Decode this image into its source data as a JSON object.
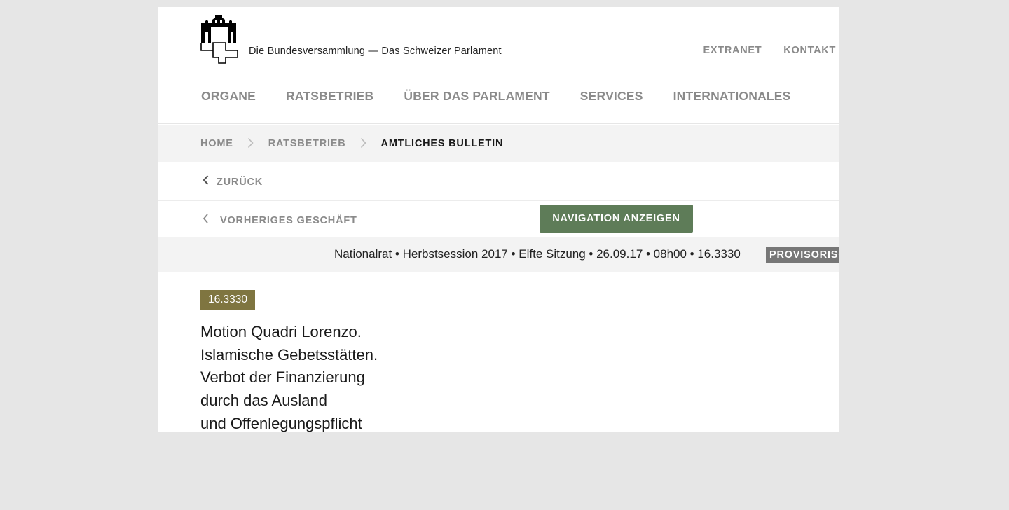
{
  "header": {
    "site_title": "Die Bundesversammlung — Das Schweizer Parlament",
    "meta_links": [
      "EXTRANET",
      "KONTAKT"
    ]
  },
  "main_nav": {
    "items": [
      "ORGANE",
      "RATSBETRIEB",
      "ÜBER DAS PARLAMENT",
      "SERVICES",
      "INTERNATIONALES"
    ]
  },
  "breadcrumb": {
    "items": [
      "HOME",
      "RATSBETRIEB",
      "AMTLICHES BULLETIN"
    ]
  },
  "back": {
    "label": "ZURÜCK"
  },
  "geschaeft_nav": {
    "previous_label": "VORHERIGES GESCHÄFT",
    "show_navigation_label": "NAVIGATION ANZEIGEN"
  },
  "session": {
    "info": "Nationalrat • Herbstsession 2017 • Elfte Sitzung • 26.09.17 • 08h00 • 16.3330",
    "status": "PROVISORISC"
  },
  "geschaeft": {
    "number": "16.3330",
    "title_lines": [
      "Motion Quadri Lorenzo.",
      "Islamische Gebetsstätten.",
      "Verbot der Finanzierung",
      "durch das Ausland",
      "und Offenlegungspflicht"
    ]
  },
  "colors": {
    "background": "#e6e6e6",
    "nav_button": "#5e7c58",
    "geschaeft_badge": "#7f7540",
    "status_badge": "#777777",
    "muted_text": "#8a8a8a"
  }
}
